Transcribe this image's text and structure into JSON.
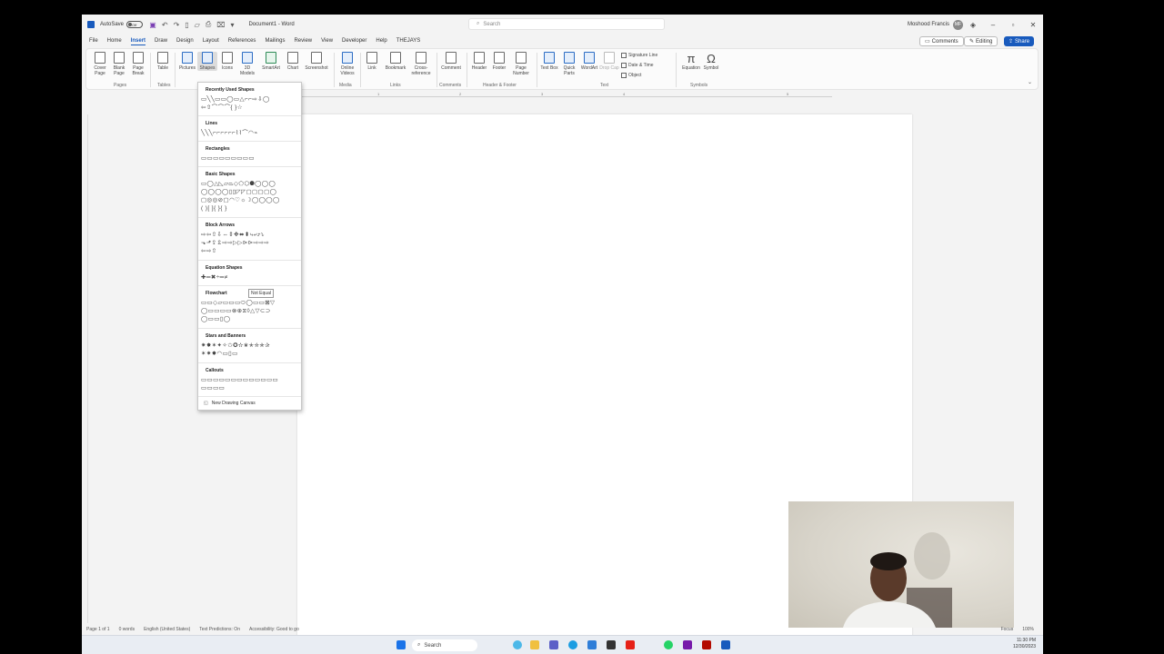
{
  "titlebar": {
    "autosave_label": "AutoSave",
    "autosave_state": "Off",
    "doc_title": "Document1 - Word",
    "search_placeholder": "Search",
    "user_name": "Moshood Francis",
    "user_initials": "MF"
  },
  "tabs": [
    "File",
    "Home",
    "Insert",
    "Draw",
    "Design",
    "Layout",
    "References",
    "Mailings",
    "Review",
    "View",
    "Developer",
    "Help",
    "THEJAYS"
  ],
  "active_tab": "Insert",
  "actions": {
    "comments": "Comments",
    "editing": "Editing",
    "share": "Share"
  },
  "ribbon": {
    "items": [
      {
        "label": "Cover Page",
        "icon": "cover-page-icon"
      },
      {
        "label": "Blank Page",
        "icon": "blank-page-icon"
      },
      {
        "label": "Page Break",
        "icon": "page-break-icon"
      },
      {
        "label": "Table",
        "icon": "table-icon"
      },
      {
        "label": "Pictures",
        "icon": "pictures-icon"
      },
      {
        "label": "Shapes",
        "icon": "shapes-icon"
      },
      {
        "label": "Icons",
        "icon": "icons-icon"
      },
      {
        "label": "3D Models",
        "icon": "3d-models-icon"
      },
      {
        "label": "SmartArt",
        "icon": "smartart-icon"
      },
      {
        "label": "Chart",
        "icon": "chart-icon"
      },
      {
        "label": "Screenshot",
        "icon": "screenshot-icon"
      },
      {
        "label": "Online Videos",
        "icon": "online-videos-icon"
      },
      {
        "label": "Link",
        "icon": "link-icon"
      },
      {
        "label": "Bookmark",
        "icon": "bookmark-icon"
      },
      {
        "label": "Cross-reference",
        "icon": "cross-reference-icon"
      },
      {
        "label": "Comment",
        "icon": "comment-icon"
      },
      {
        "label": "Header",
        "icon": "header-icon"
      },
      {
        "label": "Footer",
        "icon": "footer-icon"
      },
      {
        "label": "Page Number",
        "icon": "page-number-icon"
      },
      {
        "label": "Text Box",
        "icon": "text-box-icon"
      },
      {
        "label": "Quick Parts",
        "icon": "quick-parts-icon"
      },
      {
        "label": "WordArt",
        "icon": "wordart-icon"
      },
      {
        "label": "Drop Cap",
        "icon": "drop-cap-icon"
      },
      {
        "label": "Equation",
        "icon": "equation-icon"
      },
      {
        "label": "Symbol",
        "icon": "symbol-icon"
      }
    ],
    "text_small": {
      "signature": "Signature Line",
      "datetime": "Date & Time",
      "object": "Object"
    },
    "groups": [
      "Pages",
      "Tables",
      "Media",
      "Links",
      "Comments",
      "Header & Footer",
      "Text",
      "Symbols"
    ]
  },
  "ruler_marks": [
    "1",
    "2",
    "3",
    "4",
    "5"
  ],
  "shapes_menu": {
    "sections": [
      {
        "title": "Recently Used Shapes",
        "rows": [
          "▭╲╲▭▭◯▭△⌐⌐⇨⇩◯",
          "⇦⇧⌒⌒⌒{ }☆"
        ]
      },
      {
        "title": "Lines",
        "rows": [
          "╲╲╲⌐⌐⌐⌐⌐⌐⌇⌇⌒◠⌁"
        ]
      },
      {
        "title": "Rectangles",
        "rows": [
          "▭▭▭▭▭▭▭▭▭"
        ]
      },
      {
        "title": "Basic Shapes",
        "rows": [
          "▭◯△◺▱⏢◇⬠⬡⯃◯◯◯",
          "◯◯◯◯▯▯◸◸▢▢▢▢◯",
          "▢◎◎⊘▢◠♡☼☽◯◯◯◯",
          "( )[ ]{ }{ }"
        ]
      },
      {
        "title": "Block Arrows",
        "rows": [
          "⇨⇦⇧⇩⇔⇕✥⬌⬍⤷⤶⤴⤵",
          "⬎⬏⇪⇫⇨⇨▷▷⊳⊳⇨⇨⇨",
          "⇦⇨⇧"
        ]
      },
      {
        "title": "Equation Shapes",
        "rows": [
          "✚═✖÷═≠"
        ]
      },
      {
        "title": "Flowchart",
        "rows": [
          "▭▭◇▱▭▭▭⬭◯▭▭⊠▽",
          "◯▭▭▭▭⊗⊕⧖◊△▽⊂⊃",
          "◯▭▭▯◯"
        ]
      },
      {
        "title": "Stars and Banners",
        "rows": [
          "✷✸✶✦✧✩✪✫✬✭✮✯✰",
          "✶✷✸◠▭▯▭"
        ]
      },
      {
        "title": "Callouts",
        "rows": [
          "▭▭▭▭▭▭▭▭▭▭▭▭▭",
          "▭▭▭▭"
        ]
      }
    ],
    "tooltip": "Not Equal",
    "new_canvas": "New Drawing Canvas"
  },
  "statusbar": {
    "page": "Page 1 of 1",
    "words": "0 words",
    "language": "English (United States)",
    "predictions": "Text Predictions: On",
    "accessibility": "Accessibility: Good to go",
    "focus": "Focus",
    "zoom": "100%"
  },
  "taskbar": {
    "search": "Search",
    "time": "11:30 PM",
    "date": "12/30/2023"
  }
}
